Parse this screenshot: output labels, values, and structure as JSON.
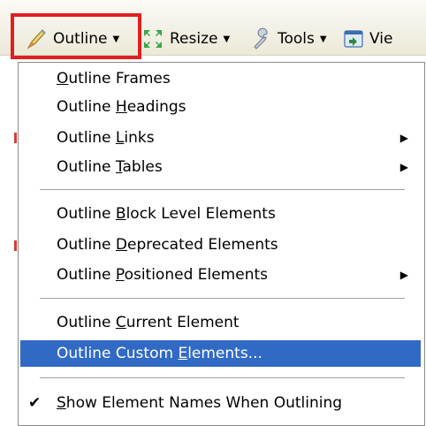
{
  "toolbar": {
    "outline": {
      "label": "Outline",
      "icon": "pencil-icon"
    },
    "resize": {
      "label": "Resize",
      "icon": "resize-arrows-icon"
    },
    "tools": {
      "label": "Tools",
      "icon": "wrench-icon"
    },
    "view": {
      "label": "Vie",
      "icon": "view-source-icon"
    }
  },
  "menu": {
    "items": [
      {
        "pre": "",
        "key": "O",
        "post": "utline Frames"
      },
      {
        "pre": "Outline ",
        "key": "H",
        "post": "eadings"
      },
      {
        "pre": "Outline ",
        "key": "L",
        "post": "inks",
        "submenu": true
      },
      {
        "pre": "Outline ",
        "key": "T",
        "post": "ables",
        "submenu": true
      },
      {
        "pre": "Outline ",
        "key": "B",
        "post": "lock Level Elements"
      },
      {
        "pre": "Outline ",
        "key": "D",
        "post": "eprecated Elements"
      },
      {
        "pre": "Outline ",
        "key": "P",
        "post": "ositioned Elements",
        "submenu": true
      },
      {
        "pre": "Outline ",
        "key": "C",
        "post": "urrent Element"
      },
      {
        "pre": "Outline Custom ",
        "key": "E",
        "post": "lements...",
        "selected": true
      },
      {
        "pre": "",
        "key": "S",
        "post": "how Element Names When Outlining",
        "checked": true
      }
    ],
    "submenu_arrow": "▶",
    "check_mark": "✔"
  },
  "colors": {
    "highlight_box": "#e02020",
    "selection": "#316ac5"
  }
}
